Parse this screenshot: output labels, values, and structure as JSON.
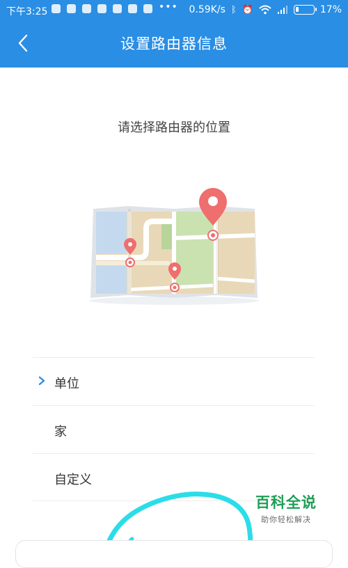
{
  "status_bar": {
    "time": "下午3:25",
    "notification_icons": [
      "location-icon",
      "app-icon",
      "app-icon",
      "app-icon",
      "plane-icon",
      "app-icon",
      "cat-icon"
    ],
    "more": "•••",
    "network_speed": "0.59K/s",
    "battery_percent": "17%",
    "battery_level": 0.17
  },
  "header": {
    "back_icon": "chevron-left-icon",
    "title": "设置路由器信息",
    "color": "#2a8ee4"
  },
  "main": {
    "prompt": "请选择路由器的位置",
    "illustration": "map-illustration"
  },
  "location_options": [
    {
      "label": "单位",
      "selected": true
    },
    {
      "label": "家",
      "selected": false
    },
    {
      "label": "自定义",
      "selected": false
    }
  ],
  "watermark": {
    "title": "百科全说",
    "subtitle": "助你轻松解决"
  },
  "colors": {
    "accent": "#2a8ee4",
    "pin": "#ef6e6e",
    "watermark": "#1e9e57",
    "scribble": "#2bdde8"
  }
}
